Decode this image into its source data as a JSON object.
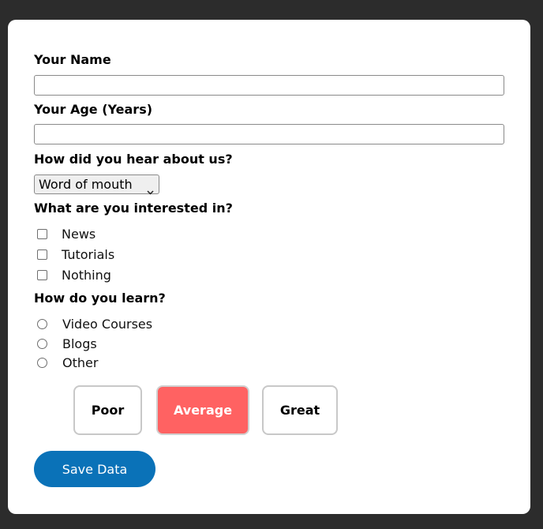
{
  "form": {
    "name_label": "Your Name",
    "name_value": "",
    "age_label": "Your Age (Years)",
    "age_value": "",
    "referral_label": "How did you hear about us?",
    "referral_selected": "Word of mouth",
    "interests_label": "What are you interested in?",
    "interests": [
      {
        "label": "News",
        "checked": false
      },
      {
        "label": "Tutorials",
        "checked": false
      },
      {
        "label": "Nothing",
        "checked": false
      }
    ],
    "learn_label": "How do you learn?",
    "learn_options": [
      {
        "label": "Video Courses",
        "selected": false
      },
      {
        "label": "Blogs",
        "selected": false
      },
      {
        "label": "Other",
        "selected": false
      }
    ],
    "ratings": [
      {
        "label": "Poor",
        "active": false
      },
      {
        "label": "Average",
        "active": true
      },
      {
        "label": "Great",
        "active": false
      }
    ],
    "save_label": "Save Data"
  },
  "colors": {
    "page_background": "#2c2c2c",
    "card_background": "#ffffff",
    "active_rating": "#ff6262",
    "save_button": "#0a72b8"
  },
  "icons": {
    "select_arrow": "chevron-down-icon",
    "number_spinner": "spinner-arrows-icon"
  }
}
